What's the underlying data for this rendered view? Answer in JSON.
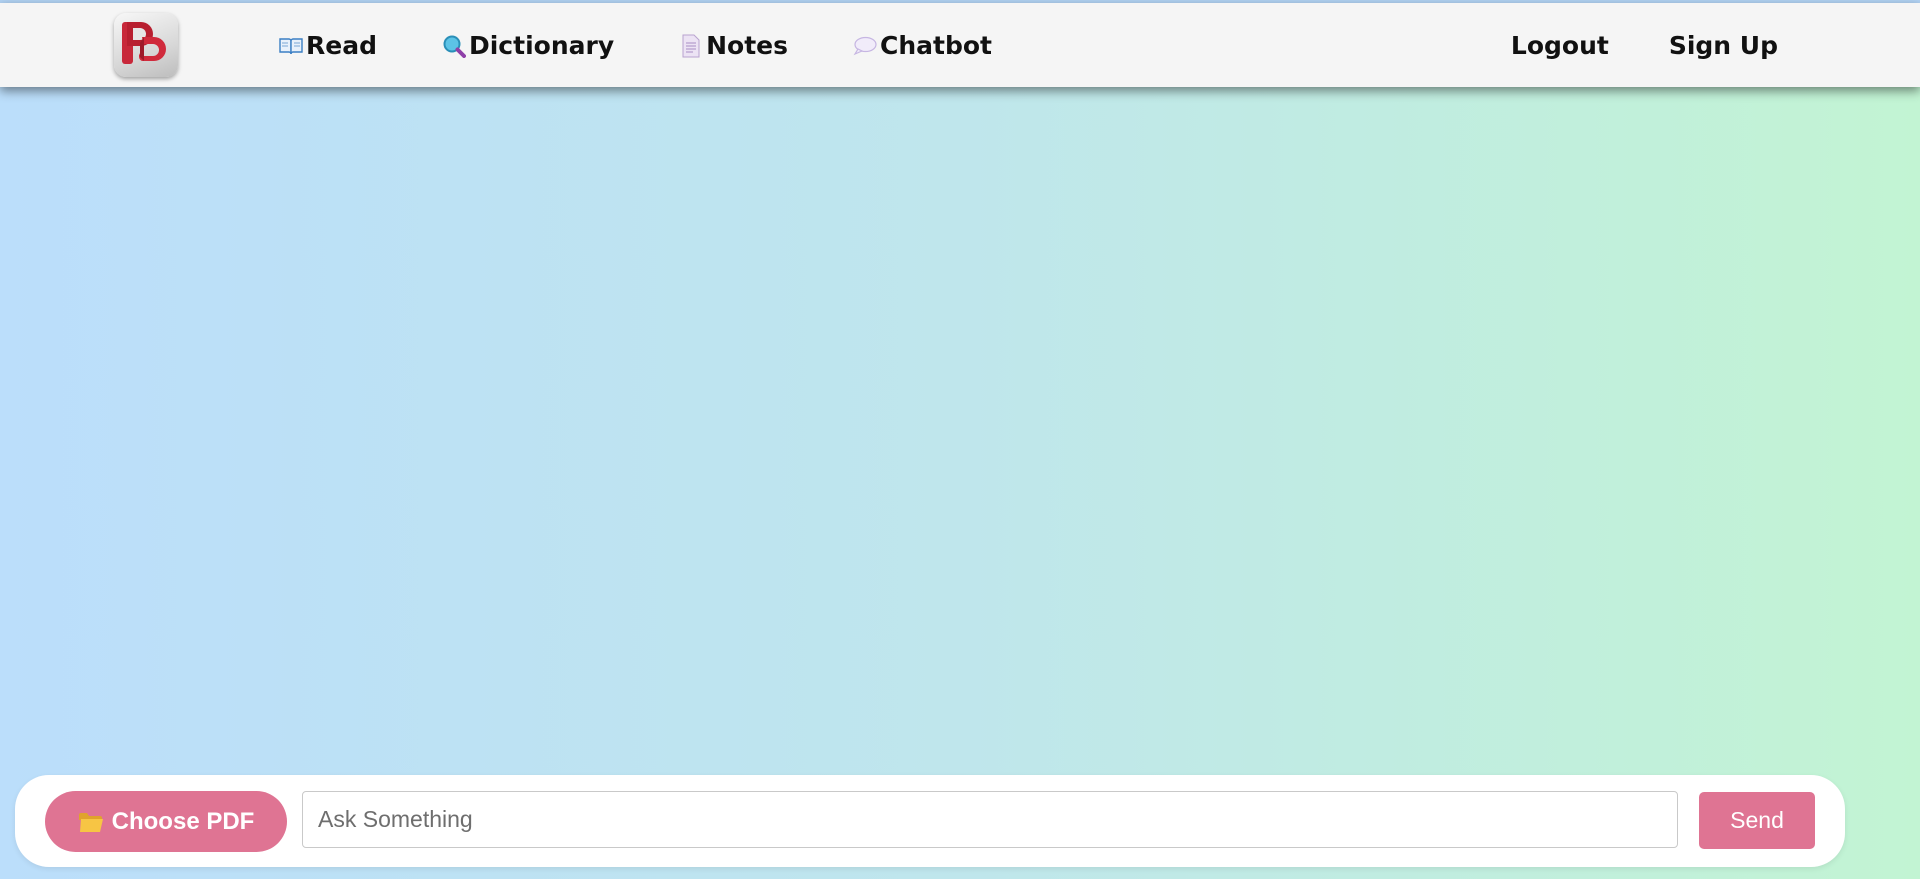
{
  "navbar": {
    "logo_icon": "pb-logo-icon",
    "links": [
      {
        "label": "Read",
        "icon": "open-book-icon"
      },
      {
        "label": "Dictionary",
        "icon": "magnifier-icon"
      },
      {
        "label": "Notes",
        "icon": "page-icon"
      },
      {
        "label": "Chatbot",
        "icon": "speech-bubble-icon"
      }
    ],
    "logout_label": "Logout",
    "signup_label": "Sign Up"
  },
  "chat": {
    "choose_pdf_label": "Choose PDF",
    "choose_pdf_icon": "folder-icon",
    "input_placeholder": "Ask Something",
    "input_value": "",
    "send_label": "Send"
  },
  "colors": {
    "accent": "#df7493",
    "navbar_bg": "#f5f5f5",
    "gradient_start": "#bbdefb",
    "gradient_end": "#c2f4d3"
  }
}
